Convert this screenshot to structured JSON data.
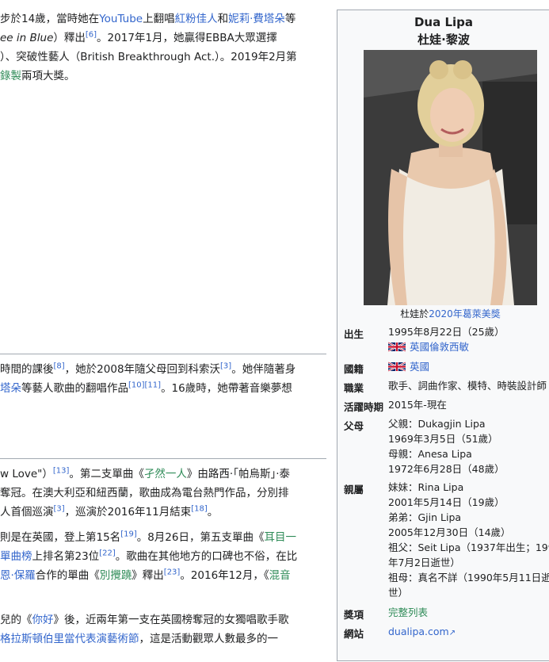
{
  "article": {
    "p1": {
      "l1": [
        "步於14歲，當時她在",
        "YouTube",
        "上翻唱",
        "紅粉佳人",
        "和",
        "妮莉·費塔朵",
        "等"
      ],
      "l2": [
        "ee in Blue",
        "）釋出",
        "[6]",
        "。2017年1月，她贏得EBBA大眾選擇"
      ],
      "l3": "）、突破性藝人（British Breakthrough Act.）。2019年2月第",
      "l4": [
        "錄製",
        "兩項大獎。"
      ]
    },
    "p2": {
      "l1": [
        "時間的課後",
        "[8]",
        "，她於2008年隨父母回到科索沃",
        "[3]",
        "。她伴隨著身"
      ],
      "l2": [
        "塔朵",
        "等藝人歌曲的翻唱作品",
        "[10][11]",
        "。16歲時，她帶著音樂夢想"
      ]
    },
    "p3": {
      "l1": [
        "w Love\"）",
        "[13]",
        "。第二支單曲《",
        "孑然一人",
        "》由路西·「帕烏斯」·泰"
      ],
      "l2": "奪冠。在澳大利亞和紐西蘭，歌曲成為電台熱門作品，分別排",
      "l3": [
        "人首個巡演",
        "[3]",
        "，巡演於2016年11月結束",
        "[18]",
        "。"
      ]
    },
    "p4": {
      "l1": [
        "則是在英國，登上第15名",
        "[19]",
        "。8月26日，第五支單曲《",
        "耳目一"
      ],
      "l2": [
        "單曲榜",
        "上排名第23位",
        "[22]",
        "。歌曲在其他地方的口碑也不俗，在比"
      ],
      "l3": [
        "恩·保羅",
        "合作的單曲《",
        "別攪蹺",
        "》釋出",
        "[23]",
        "。2016年12月，《",
        "混音"
      ]
    },
    "p5": {
      "l1": [
        "兒的《",
        "你好",
        "》後，近兩年第一支在英國榜奪冠的女獨唱歌手歌"
      ],
      "l2": [
        "格拉斯頓伯里當代表演藝術節",
        "，這是活動觀眾人數最多的一"
      ]
    }
  },
  "infobox": {
    "name_en": "Dua Lipa",
    "name_zh": "杜娃·黎波",
    "caption_prefix": "杜娃於",
    "caption_link": "2020年葛萊美獎",
    "rows": {
      "born": {
        "label": "出生",
        "date": "1995年8月22日（25歲）",
        "place": "英國倫敦西敏"
      },
      "nationality": {
        "label": "國籍",
        "value": "英國"
      },
      "occupation": {
        "label": "職業",
        "value": "歌手、詞曲作家、模特、時裝設計師"
      },
      "active": {
        "label": "活躍時期",
        "value": "2015年-現在"
      },
      "parents": {
        "label": "父母",
        "lines": [
          "父親：Dukagjin Lipa",
          "1969年3月5日（51歲）",
          "母親：Anesa Lipa",
          "1972年6月28日（48歲）"
        ]
      },
      "relatives": {
        "label": "親屬",
        "lines": [
          "妹妹：Rina Lipa",
          "2001年5月14日（19歲）",
          "弟弟：Gjin Lipa",
          "2005年12月30日（14歲）",
          "祖父：Seit Lipa（1937年出生；199",
          "年7月2日逝世）",
          "祖母：真名不詳（1990年5月11日逝",
          "世）"
        ]
      },
      "awards": {
        "label": "獎項",
        "value": "完整列表"
      },
      "website": {
        "label": "網站",
        "value": "dualipa.com"
      }
    }
  },
  "colors": {
    "link": "#3366cc",
    "visited_link": "#2e8b57",
    "infobox_bg": "#f8f9fa",
    "border": "#a2a9b1"
  }
}
